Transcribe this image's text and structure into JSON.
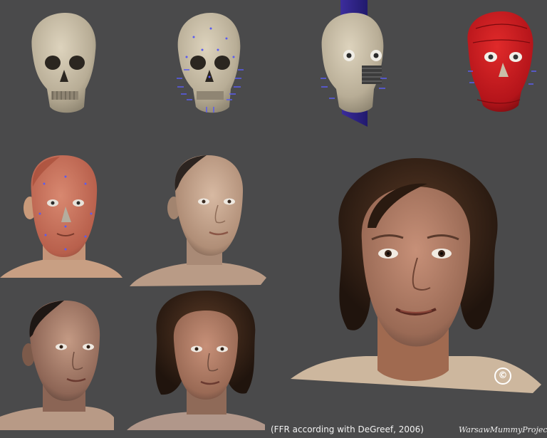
{
  "caption": "(FFR according with DeGreef, 2006)",
  "credit": "WarsawMummyProject",
  "copyright_mark": "c",
  "colors": {
    "background": "#4a4a4b",
    "bone": "#cbc1ac",
    "muscle": "#c0181b",
    "skin": "#b88e76",
    "hair": "#3a2518",
    "marker": "#5a5cf0"
  },
  "panels": [
    {
      "name": "skull",
      "label": ""
    },
    {
      "name": "skull-with-tissue-markers",
      "label": ""
    },
    {
      "name": "skull-with-eyes-nose-projection",
      "label": ""
    },
    {
      "name": "muscle-layer",
      "label": ""
    },
    {
      "name": "skin-layer-markers",
      "label": ""
    },
    {
      "name": "bald-head-smooth",
      "label": ""
    },
    {
      "name": "bald-head-textured",
      "label": ""
    },
    {
      "name": "head-with-hair-small",
      "label": ""
    },
    {
      "name": "final-reconstruction",
      "label": ""
    }
  ]
}
